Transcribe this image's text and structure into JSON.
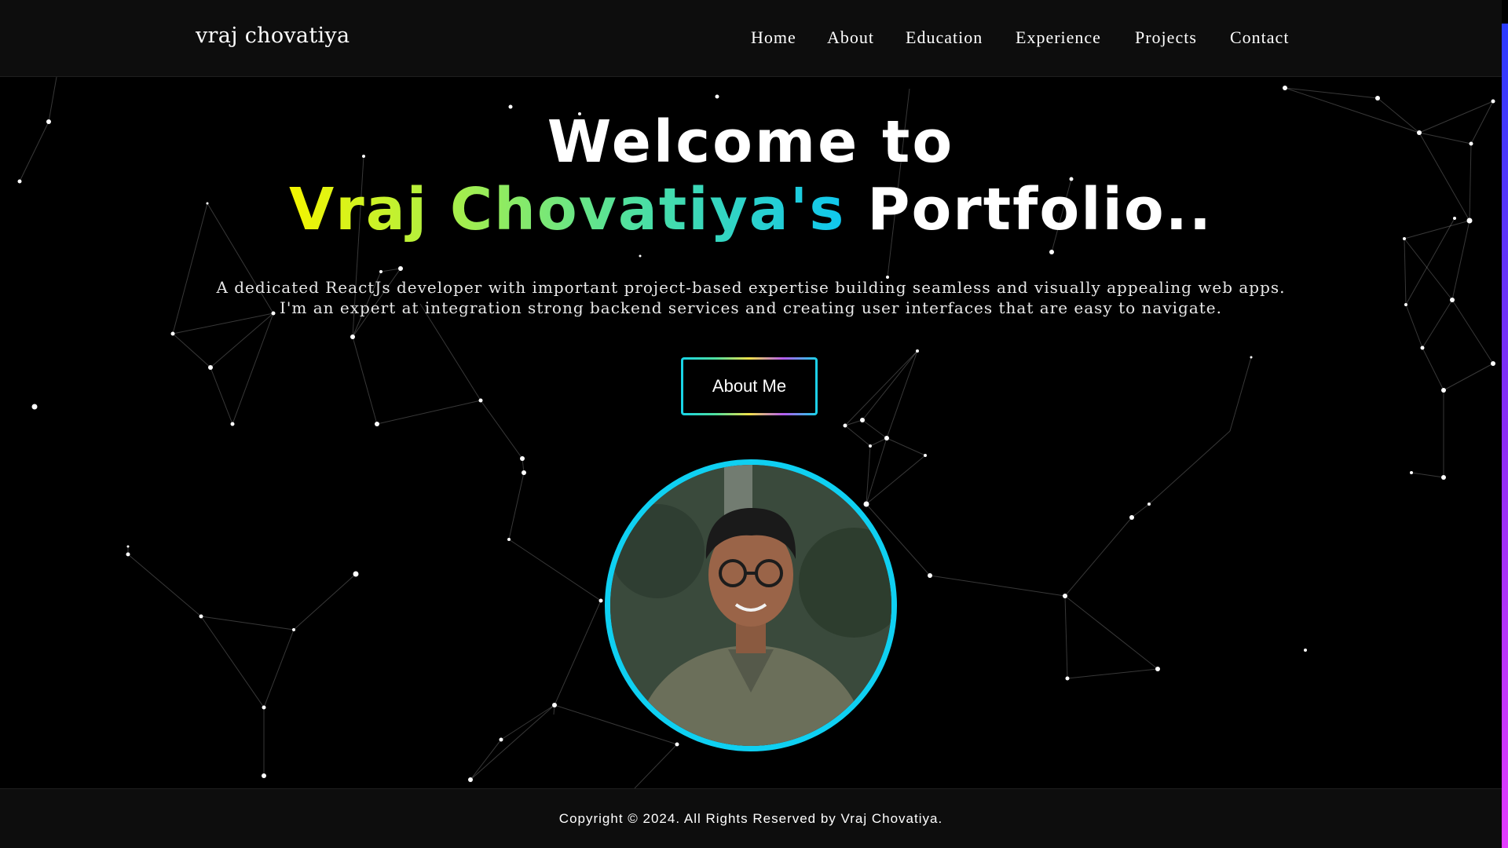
{
  "navbar": {
    "brand": "vraj chovatiya",
    "links": [
      {
        "label": "Home"
      },
      {
        "label": "About"
      },
      {
        "label": "Education"
      },
      {
        "label": "Experience"
      },
      {
        "label": "Projects"
      },
      {
        "label": "Contact"
      }
    ]
  },
  "hero": {
    "title_line1": "Welcome to",
    "name_part": "Vraj Chovatiya's",
    "title_suffix": " Portfolio..",
    "description_line1": "A dedicated ReactJs developer with important project-based expertise building seamless and visually appealing web apps.",
    "description_line2": "I'm an expert at integration strong backend services and creating user interfaces that are easy to navigate.",
    "about_button": "About Me"
  },
  "avatar": {
    "icon": "profile-photo"
  },
  "footer": {
    "copyright": "Copyright © 2024. All Rights Reserved by Vraj Chovatiya."
  },
  "colors": {
    "background": "#000000",
    "navbar_bg": "#0d0d0d",
    "accent_cyan": "#0fd0f2",
    "gradient_start": "#f4f500",
    "gradient_end": "#0fc7ef"
  }
}
